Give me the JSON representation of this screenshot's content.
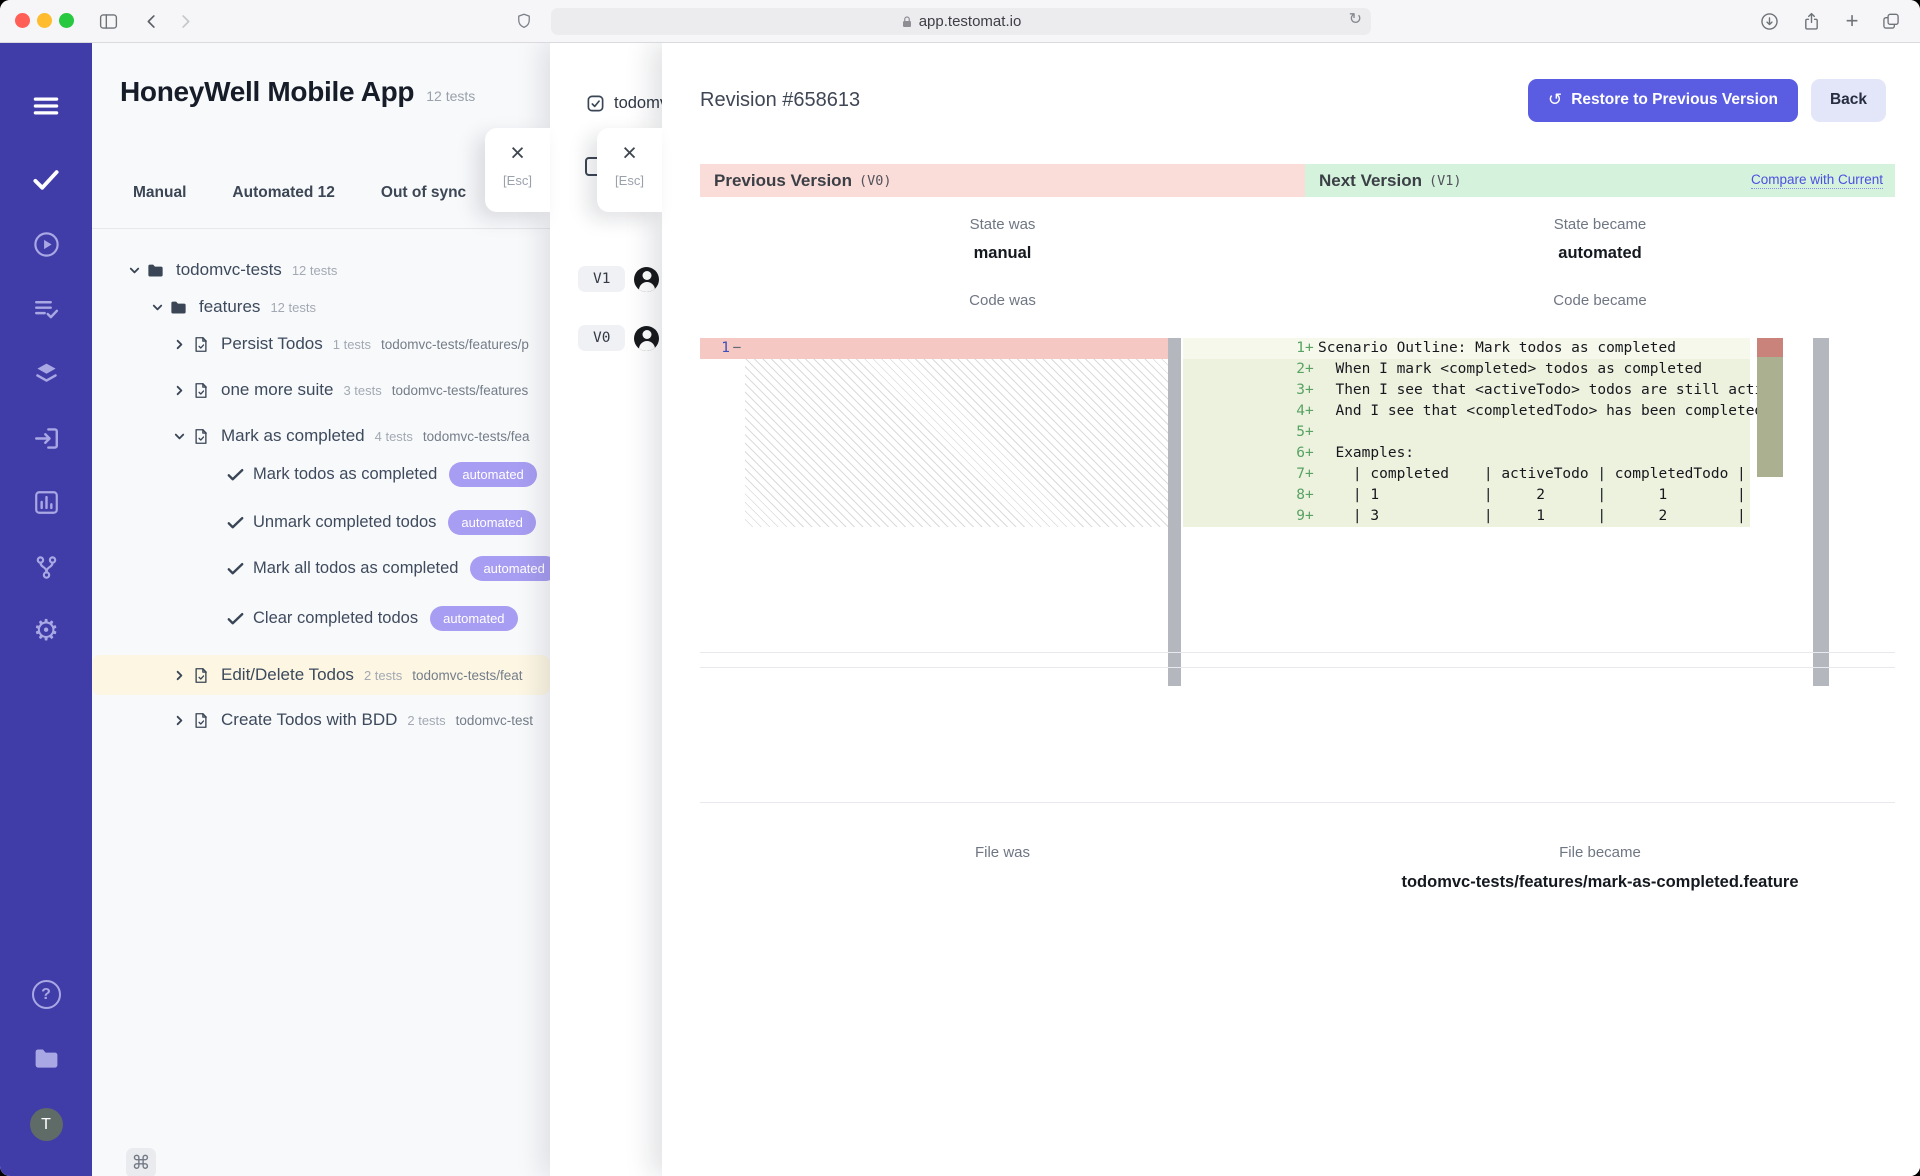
{
  "browser": {
    "url": "app.testomat.io"
  },
  "esc_hint": "[Esc]",
  "colors": {
    "accent": "#5a5ce2",
    "accent_soft": "#e3e5f9",
    "badge": "#a79df2",
    "rail": "#403da8",
    "prev_band": "#fadcd9",
    "next_band": "#d5f2dc",
    "removed_line": "#f6c8c4",
    "added_block": "#edf2df",
    "highlight_row": "#fcf6e3"
  },
  "rail": {
    "icons": [
      "menu",
      "tests",
      "runs",
      "test-plans",
      "suites",
      "import",
      "analytics",
      "branches",
      "settings",
      "help",
      "projects"
    ],
    "avatar": "T"
  },
  "tree": {
    "title": "HoneyWell Mobile App",
    "meta": "12 tests",
    "cmd": "⌘",
    "tabs": [
      {
        "label": "Manual"
      },
      {
        "label": "Automated 12"
      },
      {
        "label": "Out of sync"
      }
    ],
    "rows": [
      {
        "type": "folder",
        "level": 1,
        "expanded": true,
        "label": "todomvc-tests",
        "count": "12 tests"
      },
      {
        "type": "folder",
        "level": 2,
        "expanded": true,
        "label": "features",
        "count": "12 tests"
      },
      {
        "type": "suite",
        "level": 3,
        "expanded": false,
        "label": "Persist Todos",
        "count": "1 tests",
        "path": "todomvc-tests/features/p"
      },
      {
        "type": "suite",
        "level": 3,
        "expanded": false,
        "label": "one more suite",
        "count": "3 tests",
        "path": "todomvc-tests/features"
      },
      {
        "type": "suite",
        "level": 3,
        "expanded": true,
        "label": "Mark as completed",
        "count": "4 tests",
        "path": "todomvc-tests/fea"
      },
      {
        "type": "test",
        "label": "Mark todos as completed",
        "badge": "automated"
      },
      {
        "type": "test",
        "label": "Unmark completed todos",
        "badge": "automated"
      },
      {
        "type": "test",
        "label": "Mark all todos as completed",
        "badge": "automated"
      },
      {
        "type": "test",
        "label": "Clear completed todos",
        "badge": "automated"
      },
      {
        "type": "suite",
        "level": 3,
        "expanded": false,
        "label": "Edit/Delete Todos",
        "count": "2 tests",
        "path": "todomvc-tests/feat",
        "highlight": true
      },
      {
        "type": "suite",
        "level": 3,
        "expanded": false,
        "label": "Create Todos with BDD",
        "count": "2 tests",
        "path": "todomvc-test"
      }
    ]
  },
  "panel1": {
    "header": "todomvc-tests",
    "versions": [
      {
        "label": "V1"
      },
      {
        "label": "V0"
      }
    ]
  },
  "revision": {
    "title": "Revision #658613",
    "restore_label": "Restore to Previous Version",
    "back_label": "Back",
    "prev": {
      "label": "Previous Version",
      "tag": "(V0)"
    },
    "next": {
      "label": "Next Version",
      "tag": "(V1)"
    },
    "compare_link": "Compare with Current",
    "state": {
      "was_label": "State was",
      "was": "manual",
      "became_label": "State became",
      "became": "automated"
    },
    "code": {
      "was_label": "Code was",
      "became_label": "Code became"
    },
    "file": {
      "was_label": "File was",
      "became_label": "File became",
      "became": "todomvc-tests/features/mark-as-completed.feature"
    },
    "diff": {
      "removed": {
        "n": "1",
        "sign": "−"
      },
      "added": [
        {
          "n": "1",
          "t": "Scenario Outline: Mark todos as completed"
        },
        {
          "n": "2",
          "t": "  When I mark <completed> todos as completed"
        },
        {
          "n": "3",
          "t": "  Then I see that <activeTodo> todos are still active"
        },
        {
          "n": "4",
          "t": "  And I see that <completedTodo> has been completed"
        },
        {
          "n": "5",
          "t": ""
        },
        {
          "n": "6",
          "t": "  Examples:"
        },
        {
          "n": "7",
          "t": "    | completed    | activeTodo | completedTodo |"
        },
        {
          "n": "8",
          "t": "    | 1            |     2      |      1        |"
        },
        {
          "n": "9",
          "t": "    | 3            |     1      |      2        |"
        }
      ]
    }
  }
}
